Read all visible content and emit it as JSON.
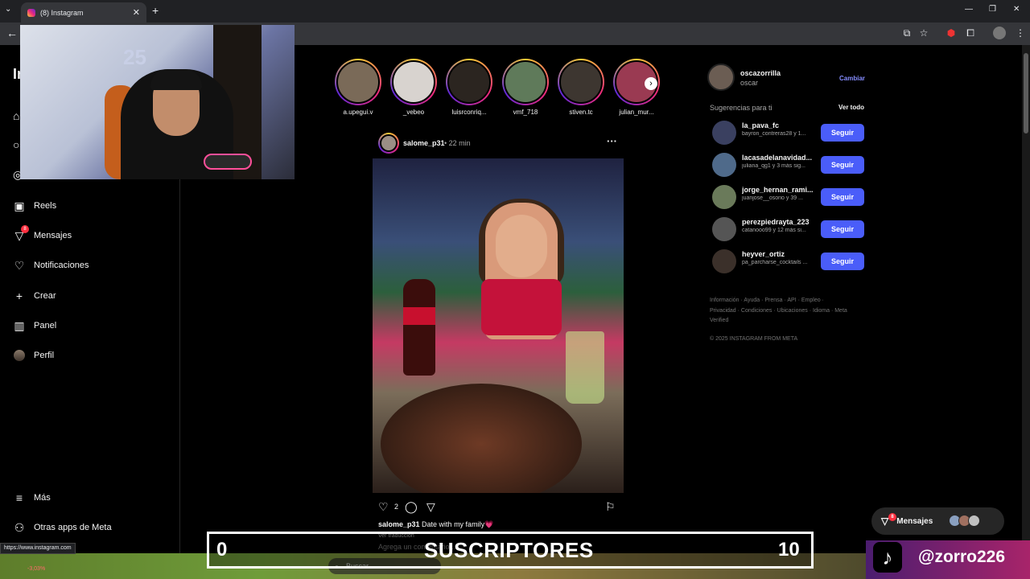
{
  "browser": {
    "tab_title": "(8) Instagram",
    "new_tab": "+",
    "tab_close": "✕",
    "status_url": "https://www.instagram.com"
  },
  "sidebar": {
    "logo": "In",
    "items": [
      {
        "label": "Reels",
        "icon": "reels-icon"
      },
      {
        "label": "Mensajes",
        "icon": "messages-icon",
        "badge": "8"
      },
      {
        "label": "Notificaciones",
        "icon": "heart-icon"
      },
      {
        "label": "Crear",
        "icon": "plus-icon"
      },
      {
        "label": "Panel",
        "icon": "dashboard-icon"
      },
      {
        "label": "Perfil",
        "icon": "avatar"
      }
    ],
    "bottom": [
      {
        "label": "Más",
        "icon": "hamburger-icon"
      },
      {
        "label": "Otras apps de Meta",
        "icon": "meta-apps-icon"
      }
    ]
  },
  "stories": [
    {
      "name": "a.upegui.v"
    },
    {
      "name": "_vebeo"
    },
    {
      "name": "luisrconriq..."
    },
    {
      "name": "vmf_718"
    },
    {
      "name": "stiven.tc"
    },
    {
      "name": "julian_mur..."
    }
  ],
  "post": {
    "user": "salome_p31",
    "time": "• 22 min",
    "likes": "2",
    "caption_user": "salome_p31",
    "caption_text": "Date with my family",
    "caption_emoji": "💗",
    "translate": "Ver traducción",
    "comment_placeholder": "Agrega un comentario..."
  },
  "account": {
    "username": "oscazorrilla",
    "name": "oscar",
    "switch": "Cambiar"
  },
  "suggestions": {
    "title": "Sugerencias para ti",
    "see_all": "Ver todo",
    "follow_label": "Seguir",
    "items": [
      {
        "user": "la_pava_fc",
        "sub": "bayron_contreras28 y 1..."
      },
      {
        "user": "lacasadelanavidad...",
        "sub": "juliana_qg1 y 3 más sig..."
      },
      {
        "user": "jorge_hernan_rami...",
        "sub": "juanjose__osorio y 39 ..."
      },
      {
        "user": "perezpiedrayta_223",
        "sub": "catanooo99 y 12 más si..."
      },
      {
        "user": "heyver_ortiz",
        "sub": "pa_parcharse_cocktails ..."
      }
    ]
  },
  "footer": {
    "links": "Información · Ayuda · Prensa · API · Empleo · Privacidad · Condiciones · Ubicaciones · Idioma · Meta Verified",
    "copyright": "© 2025 INSTAGRAM FROM META"
  },
  "messages_pill": {
    "label": "Mensajes",
    "badge": "8"
  },
  "overlay": {
    "sub_left": "0",
    "sub_title": "SUSCRIPTORES",
    "sub_right": "10",
    "tiktok_handle": "@zorro226"
  },
  "taskbar": {
    "search_placeholder": "Buscar",
    "stock": "-3,03%"
  },
  "colors": {
    "accent": "#4a5df9",
    "link": "#858cff",
    "notification": "#ff3040"
  }
}
